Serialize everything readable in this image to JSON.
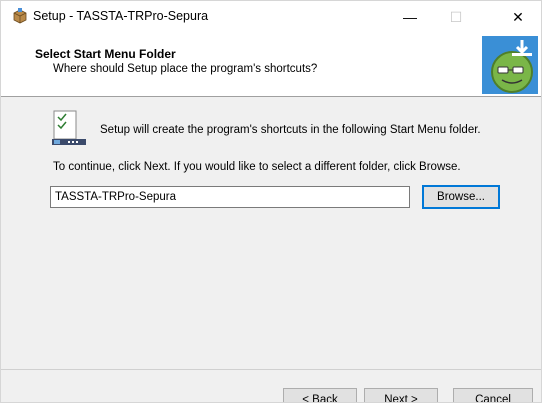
{
  "window": {
    "title": "Setup - TASSTA-TRPro-Sepura",
    "app_icon": "setup-box-icon",
    "controls": {
      "minimize_icon": "minimize-icon",
      "maximize_icon": "maximize-icon",
      "close_icon": "close-icon",
      "minimize_glyph": "—",
      "maximize_glyph": "☐",
      "close_glyph": "✕"
    }
  },
  "header": {
    "title": "Select Start Menu Folder",
    "subtitle": "Where should Setup place the program's shortcuts?",
    "logo_icon": "wizard-logo-icon"
  },
  "body": {
    "folder_icon": "start-menu-folder-icon",
    "intro": "Setup will create the program's shortcuts in the following Start Menu folder.",
    "instruction": "To continue, click Next. If you would like to select a different folder, click Browse.",
    "folder_value": "TASSTA-TRPro-Sepura",
    "browse_label": "Browse..."
  },
  "footer": {
    "back_label": "< Back",
    "next_label": "Next >",
    "cancel_label": "Cancel"
  },
  "colors": {
    "window_bg": "#f0f0f0",
    "header_bg": "#ffffff",
    "focus_accent": "#0078d7",
    "logo_bg": "#3a8fd6",
    "logo_face": "#7ab648"
  }
}
